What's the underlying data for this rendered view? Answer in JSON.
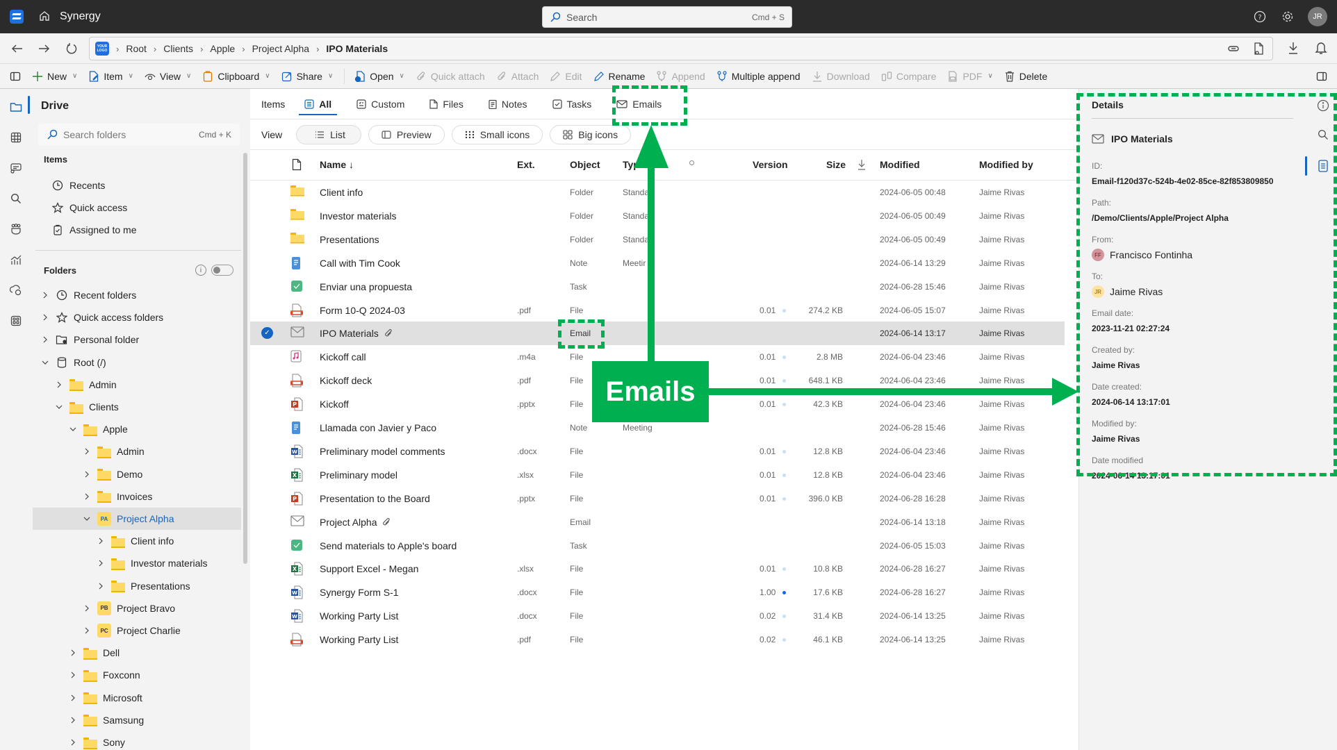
{
  "titlebar": {
    "app_name": "Synergy",
    "search_placeholder": "Search",
    "search_shortcut": "Cmd + S",
    "user_initials": "JR"
  },
  "breadcrumb": [
    "Root",
    "Clients",
    "Apple",
    "Project Alpha",
    "IPO Materials"
  ],
  "logo_text": "YOUR LOGO HERE",
  "toolbar": {
    "items": [
      {
        "label": "New",
        "icon": "plus-icon",
        "dropdown": true,
        "disabled": false
      },
      {
        "label": "Item",
        "icon": "item-icon",
        "dropdown": true,
        "disabled": false
      },
      {
        "label": "View",
        "icon": "eye-icon",
        "dropdown": true,
        "disabled": false
      },
      {
        "label": "Clipboard",
        "icon": "clipboard-icon",
        "dropdown": true,
        "disabled": false
      },
      {
        "label": "Share",
        "icon": "share-icon",
        "dropdown": true,
        "disabled": false
      },
      {
        "label": "Open",
        "icon": "open-icon",
        "dropdown": true,
        "disabled": false
      },
      {
        "label": "Quick attach",
        "icon": "paperclip-icon",
        "dropdown": false,
        "disabled": true
      },
      {
        "label": "Attach",
        "icon": "paperclip-icon",
        "dropdown": false,
        "disabled": true
      },
      {
        "label": "Edit",
        "icon": "pencil-icon",
        "dropdown": false,
        "disabled": true
      },
      {
        "label": "Rename",
        "icon": "pencil-icon",
        "dropdown": false,
        "disabled": false
      },
      {
        "label": "Append",
        "icon": "append-icon",
        "dropdown": false,
        "disabled": true
      },
      {
        "label": "Multiple append",
        "icon": "append-icon",
        "dropdown": false,
        "disabled": false
      },
      {
        "label": "Download",
        "icon": "download-icon",
        "dropdown": false,
        "disabled": true
      },
      {
        "label": "Compare",
        "icon": "compare-icon",
        "dropdown": false,
        "disabled": true
      },
      {
        "label": "PDF",
        "icon": "pdf-icon",
        "dropdown": true,
        "disabled": true
      },
      {
        "label": "Delete",
        "icon": "trash-icon",
        "dropdown": false,
        "disabled": false
      }
    ]
  },
  "sidebar": {
    "title": "Drive",
    "search_placeholder": "Search folders",
    "search_shortcut": "Cmd + K",
    "items_heading": "Items",
    "items": [
      "Recents",
      "Quick access",
      "Assigned to me"
    ],
    "folders_heading": "Folders",
    "tree": [
      {
        "label": "Recent folders",
        "level": 0,
        "kind": "clock"
      },
      {
        "label": "Quick access folders",
        "level": 0,
        "kind": "star"
      },
      {
        "label": "Personal folder",
        "level": 0,
        "kind": "personal"
      },
      {
        "label": "Root (/)",
        "level": 0,
        "kind": "db",
        "expanded": true
      },
      {
        "label": "Admin",
        "level": 1,
        "kind": "folder"
      },
      {
        "label": "Clients",
        "level": 1,
        "kind": "folder",
        "expanded": true
      },
      {
        "label": "Apple",
        "level": 2,
        "kind": "folder",
        "expanded": true
      },
      {
        "label": "Admin",
        "level": 3,
        "kind": "folder"
      },
      {
        "label": "Demo",
        "level": 3,
        "kind": "folder"
      },
      {
        "label": "Invoices",
        "level": 3,
        "kind": "folder"
      },
      {
        "label": "Project Alpha",
        "level": 3,
        "kind": "project",
        "badge": "PA",
        "expanded": true,
        "selected": true
      },
      {
        "label": "Client info",
        "level": 4,
        "kind": "folder"
      },
      {
        "label": "Investor materials",
        "level": 4,
        "kind": "folder"
      },
      {
        "label": "Presentations",
        "level": 4,
        "kind": "folder"
      },
      {
        "label": "Project Bravo",
        "level": 3,
        "kind": "project",
        "badge": "PB"
      },
      {
        "label": "Project Charlie",
        "level": 3,
        "kind": "project",
        "badge": "PC"
      },
      {
        "label": "Dell",
        "level": 2,
        "kind": "folder"
      },
      {
        "label": "Foxconn",
        "level": 2,
        "kind": "folder"
      },
      {
        "label": "Microsoft",
        "level": 2,
        "kind": "folder"
      },
      {
        "label": "Samsung",
        "level": 2,
        "kind": "folder"
      },
      {
        "label": "Sony",
        "level": 2,
        "kind": "folder"
      }
    ]
  },
  "main": {
    "tabs_label": "Items",
    "tabs": [
      {
        "label": "All",
        "active": true
      },
      {
        "label": "Custom"
      },
      {
        "label": "Files"
      },
      {
        "label": "Notes"
      },
      {
        "label": "Tasks"
      },
      {
        "label": "Emails"
      }
    ],
    "view_label": "View",
    "views": [
      {
        "label": "List",
        "active": true
      },
      {
        "label": "Preview"
      },
      {
        "label": "Small icons"
      },
      {
        "label": "Big icons"
      }
    ],
    "columns": {
      "name": "Name ↓",
      "ext": "Ext.",
      "object": "Object",
      "type": "Type",
      "version": "Version",
      "size": "Size",
      "modified": "Modified",
      "modified_by": "Modified by"
    },
    "rows": [
      {
        "name": "Client info",
        "icon": "folder",
        "ext": "",
        "object": "Folder",
        "type": "Standa",
        "version": "",
        "size": "",
        "modified": "2024-06-05 00:48",
        "modified_by": "Jaime Rivas"
      },
      {
        "name": "Investor materials",
        "icon": "folder",
        "ext": "",
        "object": "Folder",
        "type": "Standa",
        "version": "",
        "size": "",
        "modified": "2024-06-05 00:49",
        "modified_by": "Jaime Rivas"
      },
      {
        "name": "Presentations",
        "icon": "folder",
        "ext": "",
        "object": "Folder",
        "type": "Standa",
        "version": "",
        "size": "",
        "modified": "2024-06-05 00:49",
        "modified_by": "Jaime Rivas"
      },
      {
        "name": "Call with Tim Cook",
        "icon": "note",
        "ext": "",
        "object": "Note",
        "type": "Meetir",
        "version": "",
        "size": "",
        "modified": "2024-06-14 13:29",
        "modified_by": "Jaime Rivas"
      },
      {
        "name": "Enviar una propuesta",
        "icon": "task",
        "ext": "",
        "object": "Task",
        "type": "",
        "version": "",
        "size": "",
        "modified": "2024-06-28 15:46",
        "modified_by": "Jaime Rivas"
      },
      {
        "name": "Form 10-Q 2024-03",
        "icon": "pdf",
        "ext": ".pdf",
        "object": "File",
        "type": "",
        "version": "0.01",
        "size": "274.2 KB",
        "modified": "2024-06-05 15:07",
        "modified_by": "Jaime Rivas"
      },
      {
        "name": "IPO Materials",
        "icon": "email",
        "attachment": true,
        "selected": true,
        "ext": "",
        "object": "Email",
        "type": "",
        "version": "",
        "size": "",
        "modified": "2024-06-14 13:17",
        "modified_by": "Jaime Rivas"
      },
      {
        "name": "Kickoff call",
        "icon": "audio",
        "ext": ".m4a",
        "object": "File",
        "type": "",
        "version": "0.01",
        "size": "2.8 MB",
        "modified": "2024-06-04 23:46",
        "modified_by": "Jaime Rivas"
      },
      {
        "name": "Kickoff deck",
        "icon": "pdf",
        "ext": ".pdf",
        "object": "File",
        "type": "",
        "version": "0.01",
        "size": "648.1 KB",
        "modified": "2024-06-04 23:46",
        "modified_by": "Jaime Rivas"
      },
      {
        "name": "Kickoff",
        "icon": "pptx",
        "ext": ".pptx",
        "object": "File",
        "type": "",
        "version": "0.01",
        "size": "42.3 KB",
        "modified": "2024-06-04 23:46",
        "modified_by": "Jaime Rivas"
      },
      {
        "name": "Llamada con Javier y Paco",
        "icon": "note",
        "ext": "",
        "object": "Note",
        "type": "Meeting",
        "version": "",
        "size": "",
        "modified": "2024-06-28 15:46",
        "modified_by": "Jaime Rivas"
      },
      {
        "name": "Preliminary model comments",
        "icon": "docx",
        "ext": ".docx",
        "object": "File",
        "type": "",
        "version": "0.01",
        "size": "12.8 KB",
        "modified": "2024-06-04 23:46",
        "modified_by": "Jaime Rivas"
      },
      {
        "name": "Preliminary model",
        "icon": "xlsx",
        "ext": ".xlsx",
        "object": "File",
        "type": "",
        "version": "0.01",
        "size": "12.8 KB",
        "modified": "2024-06-04 23:46",
        "modified_by": "Jaime Rivas"
      },
      {
        "name": "Presentation to the Board",
        "icon": "pptx",
        "ext": ".pptx",
        "object": "File",
        "type": "",
        "version": "0.01",
        "size": "396.0 KB",
        "modified": "2024-06-28 16:28",
        "modified_by": "Jaime Rivas"
      },
      {
        "name": "Project Alpha",
        "icon": "email",
        "attachment": true,
        "ext": "",
        "object": "Email",
        "type": "",
        "version": "",
        "size": "",
        "modified": "2024-06-14 13:18",
        "modified_by": "Jaime Rivas"
      },
      {
        "name": "Send materials to Apple's board",
        "icon": "task",
        "ext": "",
        "object": "Task",
        "type": "",
        "version": "",
        "size": "",
        "modified": "2024-06-05 15:03",
        "modified_by": "Jaime Rivas"
      },
      {
        "name": "Support Excel - Megan",
        "icon": "xlsx",
        "ext": ".xlsx",
        "object": "File",
        "type": "",
        "version": "0.01",
        "size": "10.8 KB",
        "modified": "2024-06-28 16:27",
        "modified_by": "Jaime Rivas"
      },
      {
        "name": "Synergy Form S-1",
        "icon": "docx",
        "ext": ".docx",
        "object": "File",
        "type": "",
        "version": "1.00",
        "major": true,
        "size": "17.6 KB",
        "modified": "2024-06-28 16:27",
        "modified_by": "Jaime Rivas"
      },
      {
        "name": "Working Party List",
        "icon": "docx",
        "ext": ".docx",
        "object": "File",
        "type": "",
        "version": "0.02",
        "size": "31.4 KB",
        "modified": "2024-06-14 13:25",
        "modified_by": "Jaime Rivas"
      },
      {
        "name": "Working Party List",
        "icon": "pdf",
        "ext": ".pdf",
        "object": "File",
        "type": "",
        "version": "0.02",
        "size": "46.1 KB",
        "modified": "2024-06-14 13:25",
        "modified_by": "Jaime Rivas"
      }
    ]
  },
  "details": {
    "title": "Details",
    "item_name": "IPO Materials",
    "fields": [
      {
        "label": "ID:",
        "value": "Email-f120d37c-524b-4e02-85ce-82f853809850"
      },
      {
        "label": "Path:",
        "value": "/Demo/Clients/Apple/Project Alpha"
      },
      {
        "label": "From:",
        "person": "Francisco Fontinha",
        "initials": "FF",
        "avatar_color": "#d4949c"
      },
      {
        "label": "To:",
        "person": "Jaime Rivas",
        "initials": "JR",
        "avatar_color": "#fde2a0"
      },
      {
        "label": "Email date:",
        "value": "2023-11-21 02:27:24"
      },
      {
        "label": "Created by:",
        "value": "Jaime Rivas"
      },
      {
        "label": "Date created:",
        "value": "2024-06-14 13:17:01"
      },
      {
        "label": "Modified by:",
        "value": "Jaime Rivas"
      },
      {
        "label": "Date modified",
        "value": "2024-06-14 13:17:01"
      }
    ]
  },
  "annotation": {
    "label": "Emails",
    "color": "#00b050"
  },
  "colors": {
    "accent": "#1565c0",
    "titlebar": "#2b2b2b",
    "folder": "#ffd966",
    "selected_row": "#e0e0e0"
  }
}
